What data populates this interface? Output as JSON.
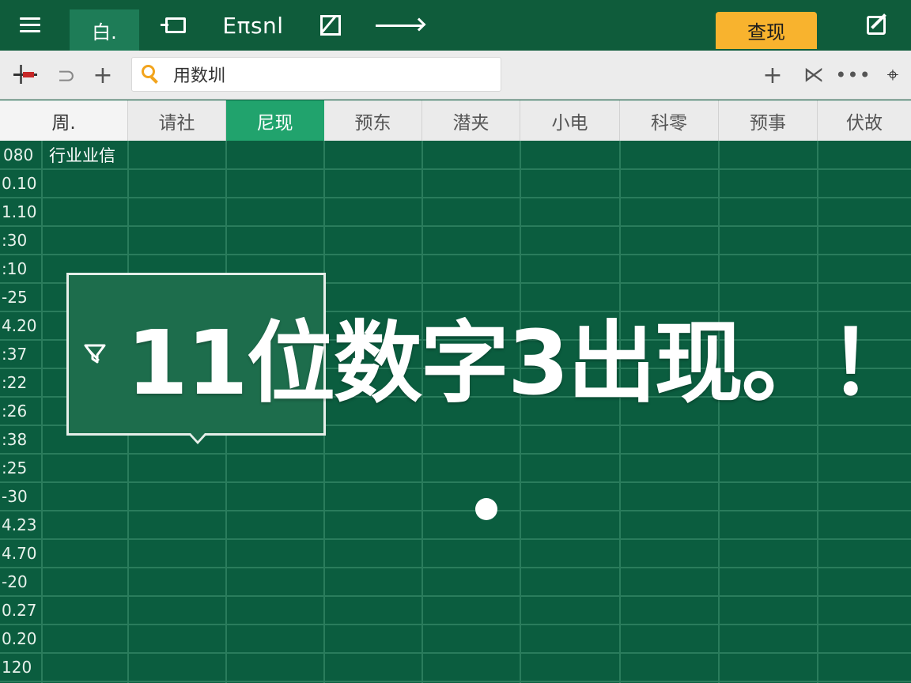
{
  "titlebar": {
    "home_tab": "白.",
    "app_name": "Eπsnl",
    "action_label": "查现"
  },
  "toolbar": {
    "search_value": "用数圳"
  },
  "columns": {
    "corner": "周.",
    "headers": [
      "请社",
      "尼现",
      "预东",
      "潜夹",
      "小电",
      "科零",
      "预事",
      "伏故"
    ]
  },
  "grid": {
    "first_cell": "行业业信",
    "row_labels": [
      "080",
      "0.10",
      "1.10",
      ":30",
      ":10",
      "-25",
      "4.20",
      ":37",
      ":22",
      ":26",
      ":38",
      ":25",
      "-30",
      "4.23",
      "4.70",
      "-20",
      "0.27",
      "0.20",
      "120"
    ]
  },
  "callout": {
    "banner_text": "11位数字3出现。！"
  },
  "colors": {
    "titlebar_bg": "#0f5c3b",
    "grid_bg": "#0b5d3f",
    "active_column": "#21a36d",
    "action_button": "#f8b32e"
  }
}
